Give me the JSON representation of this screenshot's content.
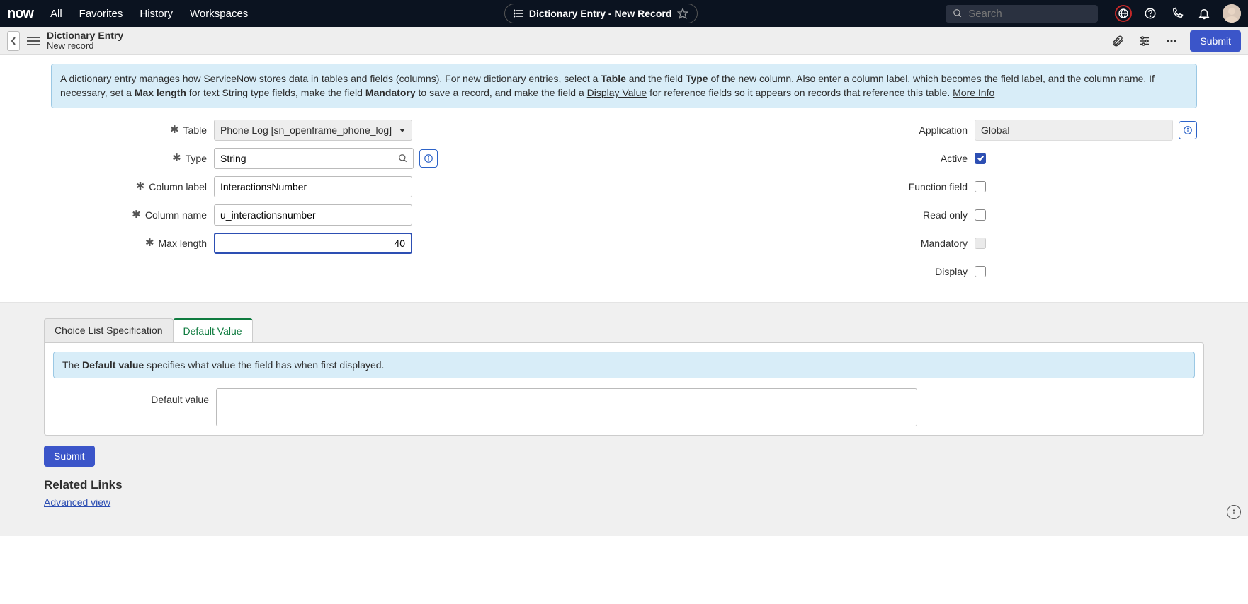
{
  "topnav": {
    "logo": "now",
    "items": [
      "All",
      "Favorites",
      "History",
      "Workspaces"
    ],
    "record_title": "Dictionary Entry - New Record",
    "search_placeholder": "Search"
  },
  "form_header": {
    "title": "Dictionary Entry",
    "subtitle": "New record",
    "submit": "Submit"
  },
  "info_box": {
    "t1": "A dictionary entry manages how ServiceNow stores data in tables and fields (columns). For new dictionary entries, select a ",
    "b1": "Table",
    "t2": " and the field ",
    "b2": "Type",
    "t3": " of the new column. Also enter a column label, which becomes the field label, and the column name. If necessary, set a ",
    "b3": "Max length",
    "t4": " for text String type fields, make the field ",
    "b4": "Mandatory",
    "t5": " to save a record, and make the field a ",
    "link1": "Display Value",
    "t6": " for reference fields so it appears on records that reference this table. ",
    "more": "More Info"
  },
  "fields_left": {
    "table": {
      "label": "Table",
      "value": "Phone Log [sn_openframe_phone_log]"
    },
    "type": {
      "label": "Type",
      "value": "String"
    },
    "column_label": {
      "label": "Column label",
      "value": "InteractionsNumber"
    },
    "column_name": {
      "label": "Column name",
      "value": "u_interactionsnumber"
    },
    "max_length": {
      "label": "Max length",
      "value": "40"
    }
  },
  "fields_right": {
    "application": {
      "label": "Application",
      "value": "Global"
    },
    "active": {
      "label": "Active",
      "checked": true
    },
    "function_field": {
      "label": "Function field",
      "checked": false
    },
    "read_only": {
      "label": "Read only",
      "checked": false
    },
    "mandatory": {
      "label": "Mandatory",
      "checked": false,
      "disabled": true
    },
    "display": {
      "label": "Display",
      "checked": false
    }
  },
  "tabs": {
    "choice": "Choice List Specification",
    "default": "Default Value",
    "default_info_pre": "The ",
    "default_info_bold": "Default value",
    "default_info_post": " specifies what value the field has when first displayed.",
    "default_label": "Default value",
    "default_value": ""
  },
  "bottom": {
    "submit": "Submit",
    "related_heading": "Related Links",
    "advanced_view": "Advanced view"
  }
}
